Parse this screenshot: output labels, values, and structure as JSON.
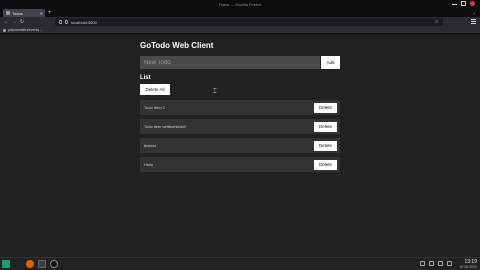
{
  "window": {
    "title": "Todos — Mozilla Firefox"
  },
  "tabs": [
    {
      "label": "Todos",
      "close": "✕"
    }
  ],
  "tabbar": {
    "new_tab": "+",
    "list_tabs": "⌄"
  },
  "navbar": {
    "back": "←",
    "forward": "→",
    "reload": "↻",
    "url": "localhost:3000",
    "bookmark_star": "☆"
  },
  "bookmarks": [
    {
      "label": "pulpocreativeevents..."
    }
  ],
  "app": {
    "title": "GoTodo Web Client",
    "input_placeholder": "New Todo",
    "add_label": "Add",
    "list_heading": "List",
    "delete_all_label": "Delete All",
    "delete_label": "Delete",
    "todos": [
      {
        "text": "Todo Item 2"
      },
      {
        "text": "Todo item writtenNewW"
      },
      {
        "text": "testest"
      },
      {
        "text": "Hello"
      }
    ]
  },
  "taskbar": {
    "time": "13:19",
    "date": "29.06.2021"
  }
}
